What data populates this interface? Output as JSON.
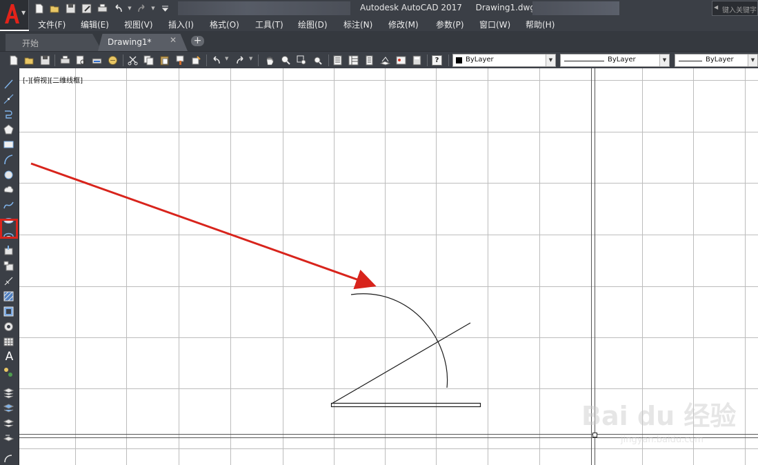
{
  "titlebar": {
    "title": "Autodesk AutoCAD 2017",
    "document": "Drawing1.dwg",
    "search_placeholder": "键入关键字"
  },
  "menu": {
    "items": [
      "文件(F)",
      "编辑(E)",
      "视图(V)",
      "插入(I)",
      "格式(O)",
      "工具(T)",
      "绘图(D)",
      "标注(N)",
      "修改(M)",
      "参数(P)",
      "窗口(W)",
      "帮助(H)"
    ]
  },
  "tabs": {
    "start": "开始",
    "drawing": "Drawing1*",
    "close_glyph": "✕",
    "add_glyph": "+"
  },
  "toolbar": {
    "color_value": "ByLayer",
    "linetype_value": "ByLayer",
    "lineweight_value": "ByLayer",
    "help_glyph": "?"
  },
  "left_toolbar": {
    "text_tool_glyph": "A",
    "highlighted_tool": "arc-icon",
    "tools": [
      "line-icon",
      "construction-line-icon",
      "polyline-icon",
      "polygon-icon",
      "rectangle-icon",
      "arc-icon",
      "circle-icon",
      "revision-cloud-icon",
      "spline-icon",
      "ellipse-icon",
      "ellipse-arc-icon",
      "insert-block-icon",
      "make-block-icon",
      "point-icon",
      "hatch-icon",
      "gradient-icon",
      "region-icon",
      "table-icon",
      "multiline-text-icon",
      "add-selected-icon"
    ]
  },
  "viewport": {
    "label": "[-][俯视][二维线框]"
  },
  "colors": {
    "chrome_dark": "#3b3f46",
    "grid": "#bcbcbc",
    "annotation_red": "#d8241c",
    "geometry": "#1a1a1a"
  },
  "watermark": {
    "brand": "Bai du 经验",
    "url": "jingyan.baidu.com"
  }
}
